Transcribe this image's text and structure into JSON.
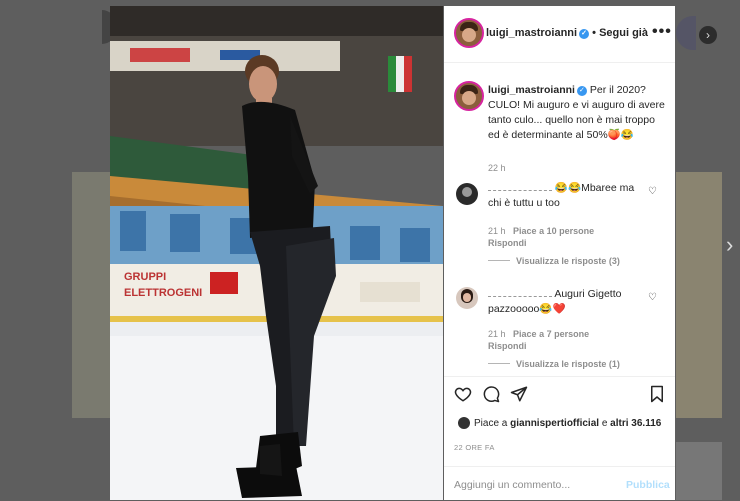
{
  "post": {
    "username": "luigi_mastroianni",
    "follow_label": "Segui già",
    "caption": "Per il 2020? CULO! Mi auguro e vi auguro di avere tanto culo... quello non è mai troppo ed è determinante al 50%🍑😂",
    "caption_time": "22 h"
  },
  "comments": [
    {
      "text": "😂😂Mbaree ma chi è tuttu u too",
      "time": "21 h",
      "likes": "Piace a 10 persone",
      "reply": "Rispondi",
      "view_replies": "Visualizza le risposte (3)"
    },
    {
      "text": "Auguri Gigetto pazzooooo😂❤️",
      "time": "21 h",
      "likes": "Piace a 7 persone",
      "reply": "Rispondi",
      "view_replies": "Visualizza le risposte (1)"
    }
  ],
  "likes": {
    "prefix": "Piace a",
    "user": "giannispertiofficial",
    "middle": "e",
    "others": "altri 36.116"
  },
  "timestamp": "22 ORE FA",
  "add_comment": {
    "placeholder": "Aggiungi un commento...",
    "publish": "Pubblica"
  },
  "icons": {
    "like": "heart-icon",
    "comment": "comment-icon",
    "share": "paper-plane-icon",
    "save": "bookmark-icon",
    "more": "more-options-icon",
    "verified": "verified-badge-icon"
  },
  "colors": {
    "accent": "#3897f0",
    "publish_disabled": "#b2dffc",
    "meta_gray": "#8e8e8e",
    "text": "#262626"
  }
}
